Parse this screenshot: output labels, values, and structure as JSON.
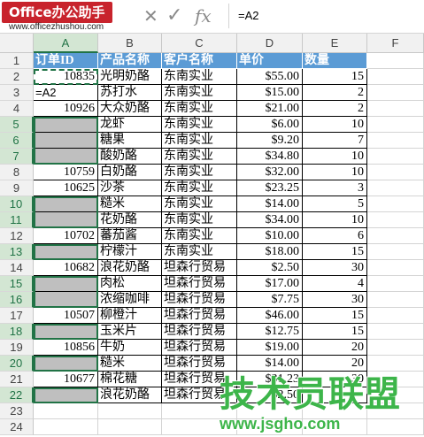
{
  "brand": {
    "logo_text": "Office办公助手",
    "website": "www.officezhushou.com"
  },
  "formula_bar": {
    "cancel_icon": "cross-icon",
    "enter_icon": "check-icon",
    "fx_label": "fx",
    "content": "=A2"
  },
  "columns": [
    "A",
    "B",
    "C",
    "D",
    "E",
    "F"
  ],
  "selected_column": "A",
  "row_numbers": [
    "1",
    "2",
    "3",
    "4",
    "5",
    "6",
    "7",
    "8",
    "9",
    "10",
    "11",
    "12",
    "13",
    "14",
    "15",
    "16",
    "17",
    "18",
    "19",
    "20",
    "21",
    "22",
    "23",
    "24"
  ],
  "header_row": {
    "order_id": "订单ID",
    "product": "产品名称",
    "customer": "客户名称",
    "price": "单价",
    "quantity": "数量"
  },
  "rows": [
    {
      "id": "10835",
      "product": "光明奶酪",
      "customer": "东南实业",
      "price": "$55.00",
      "qty": "15",
      "blank": false
    },
    {
      "id": "=A2",
      "product": "苏打水",
      "customer": "东南实业",
      "price": "$15.00",
      "qty": "2",
      "blank": false,
      "editing": true
    },
    {
      "id": "10926",
      "product": "大众奶酪",
      "customer": "东南实业",
      "price": "$21.00",
      "qty": "2",
      "blank": false
    },
    {
      "id": "",
      "product": "龙虾",
      "customer": "东南实业",
      "price": "$6.00",
      "qty": "10",
      "blank": true
    },
    {
      "id": "",
      "product": "糖果",
      "customer": "东南实业",
      "price": "$9.20",
      "qty": "7",
      "blank": true
    },
    {
      "id": "",
      "product": "酸奶酪",
      "customer": "东南实业",
      "price": "$34.80",
      "qty": "10",
      "blank": true
    },
    {
      "id": "10759",
      "product": "白奶酪",
      "customer": "东南实业",
      "price": "$32.00",
      "qty": "10",
      "blank": false
    },
    {
      "id": "10625",
      "product": "沙茶",
      "customer": "东南实业",
      "price": "$23.25",
      "qty": "3",
      "blank": false
    },
    {
      "id": "",
      "product": "糙米",
      "customer": "东南实业",
      "price": "$14.00",
      "qty": "5",
      "blank": true
    },
    {
      "id": "",
      "product": "花奶酪",
      "customer": "东南实业",
      "price": "$34.00",
      "qty": "10",
      "blank": true
    },
    {
      "id": "10702",
      "product": "蕃茄酱",
      "customer": "东南实业",
      "price": "$10.00",
      "qty": "6",
      "blank": false
    },
    {
      "id": "",
      "product": "柠檬汁",
      "customer": "东南实业",
      "price": "$18.00",
      "qty": "15",
      "blank": true
    },
    {
      "id": "10682",
      "product": "浪花奶酪",
      "customer": "坦森行贸易",
      "price": "$2.50",
      "qty": "30",
      "blank": false
    },
    {
      "id": "",
      "product": "肉松",
      "customer": "坦森行贸易",
      "price": "$17.00",
      "qty": "4",
      "blank": true
    },
    {
      "id": "",
      "product": "浓缩咖啡",
      "customer": "坦森行贸易",
      "price": "$7.75",
      "qty": "30",
      "blank": true
    },
    {
      "id": "10507",
      "product": "柳橙汁",
      "customer": "坦森行贸易",
      "price": "$46.00",
      "qty": "15",
      "blank": false
    },
    {
      "id": "",
      "product": "玉米片",
      "customer": "坦森行贸易",
      "price": "$12.75",
      "qty": "15",
      "blank": true
    },
    {
      "id": "10856",
      "product": "牛奶",
      "customer": "坦森行贸易",
      "price": "$19.00",
      "qty": "20",
      "blank": false
    },
    {
      "id": "",
      "product": "糙米",
      "customer": "坦森行贸易",
      "price": "$14.00",
      "qty": "20",
      "blank": true
    },
    {
      "id": "10677",
      "product": "棉花糖",
      "customer": "坦森行贸易",
      "price": "$31.23",
      "qty": "30",
      "blank": false
    },
    {
      "id": "",
      "product": "浪花奶酪",
      "customer": "坦森行贸易",
      "price": "$2.50",
      "qty": "",
      "blank": true
    }
  ],
  "watermark": {
    "main": "技术员联盟",
    "url": "www.jsgho.com"
  },
  "colors": {
    "header_blue": "#5b9bd5",
    "blank_gray": "#bfbfbf",
    "excel_green": "#217346",
    "logo_red": "#c8232c",
    "watermark_green": "#3db54a"
  }
}
